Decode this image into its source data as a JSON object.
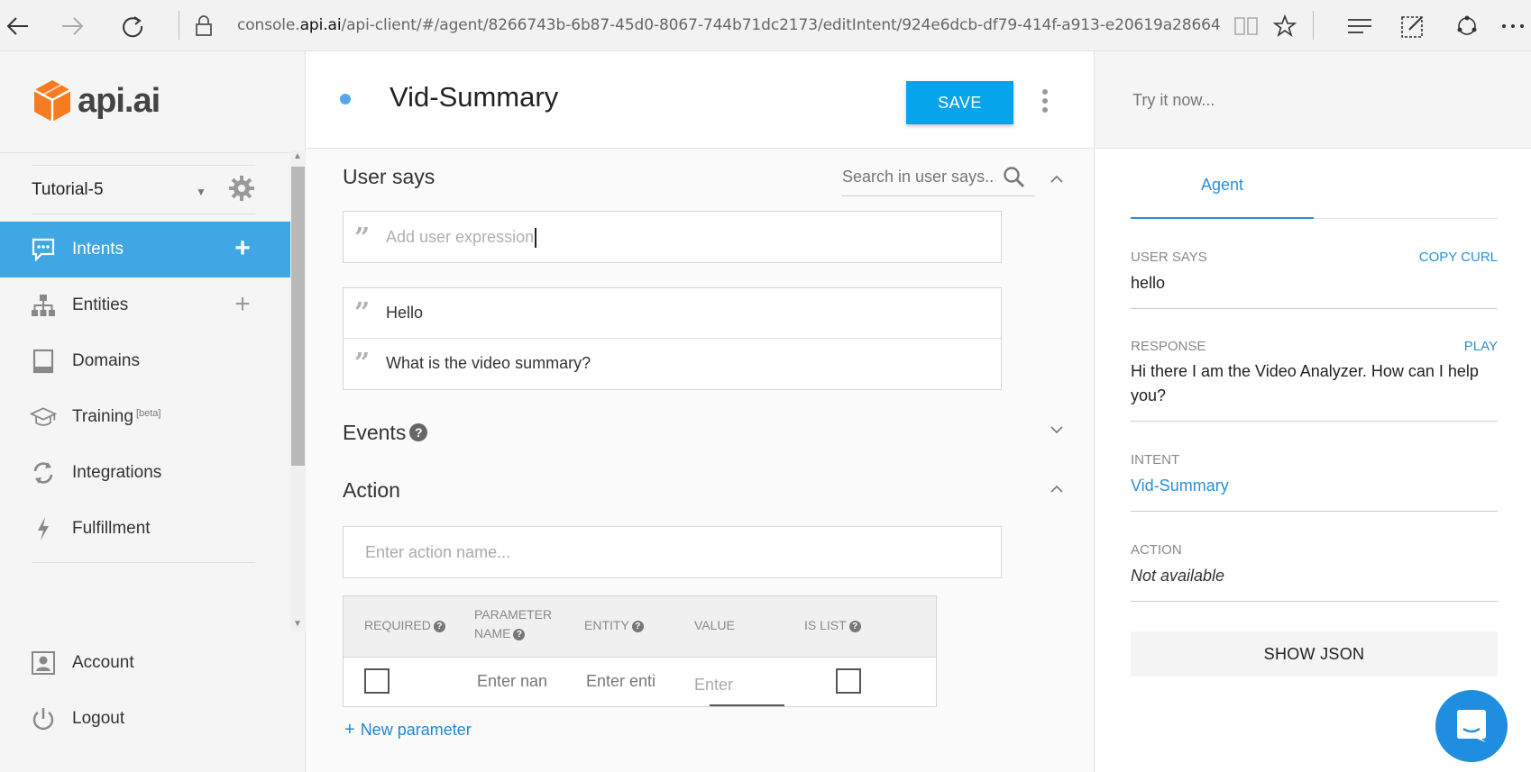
{
  "browser": {
    "url_prefix": "console.",
    "url_domain": "api.ai",
    "url_rest": "/api-client/#/agent/8266743b-6b87-45d0-8067-744b71dc2173/editIntent/924e6dcb-df79-414f-a913-e20619a28664"
  },
  "logo": {
    "text": "api.ai"
  },
  "agent": {
    "name": "Tutorial-5"
  },
  "nav": {
    "intents": "Intents",
    "entities": "Entities",
    "domains": "Domains",
    "training": "Training",
    "training_badge": "[beta]",
    "integrations": "Integrations",
    "fulfillment": "Fulfillment",
    "account": "Account",
    "logout": "Logout"
  },
  "intent": {
    "title": "Vid-Summary",
    "save_label": "SAVE"
  },
  "user_says": {
    "title": "User says",
    "search_placeholder": "Search in user says...",
    "add_placeholder": "Add user expression",
    "expressions": [
      "Hello",
      "What is the video summary?"
    ]
  },
  "events": {
    "title": "Events",
    "help": "?"
  },
  "action": {
    "title": "Action",
    "placeholder": "Enter action name...",
    "columns": {
      "required": "REQUIRED",
      "param_name_1": "PARAMETER",
      "param_name_2": "NAME",
      "entity": "ENTITY",
      "value": "VALUE",
      "is_list": "IS LIST"
    },
    "row": {
      "name_placeholder": "Enter nan",
      "entity_placeholder": "Enter enti",
      "value_placeholder": "Enter"
    },
    "new_parameter": "New parameter"
  },
  "try": {
    "placeholder": "Try it now...",
    "tab": "Agent",
    "user_says_label": "USER SAYS",
    "copy_curl": "COPY CURL",
    "user_says_value": "hello",
    "response_label": "RESPONSE",
    "play": "PLAY",
    "response_value": "Hi there I am the Video Analyzer. How can I help you?",
    "intent_label": "INTENT",
    "intent_value": "Vid-Summary",
    "action_label": "ACTION",
    "action_value": "Not available",
    "show_json": "SHOW JSON"
  },
  "colors": {
    "accent": "#3fa7e4",
    "save": "#06a4eb",
    "link": "#2b8fd6",
    "logo_orange": "#f57c22"
  }
}
